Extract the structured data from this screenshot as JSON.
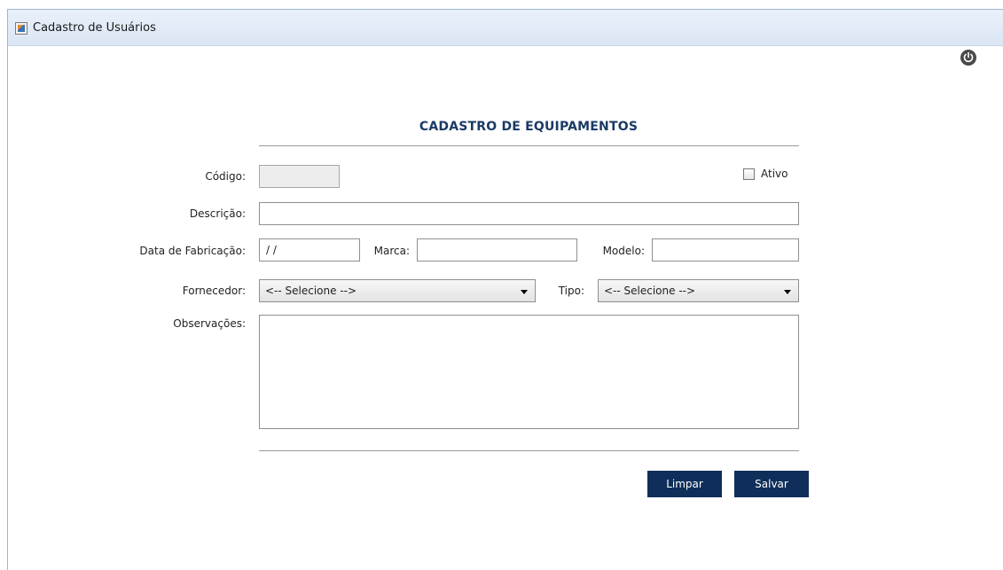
{
  "window": {
    "title": "Cadastro de Usuários"
  },
  "form": {
    "heading": "CADASTRO DE EQUIPAMENTOS",
    "codigo_label": "Código:",
    "codigo_value": "",
    "ativo_label": "Ativo",
    "ativo_checked": false,
    "descricao_label": "Descrição:",
    "descricao_value": "",
    "data_fabricacao_label": "Data de Fabricação:",
    "data_fabricacao_value": "/ /",
    "marca_label": "Marca:",
    "marca_value": "",
    "modelo_label": "Modelo:",
    "modelo_value": "",
    "fornecedor_label": "Fornecedor:",
    "fornecedor_selected": "<-- Selecione -->",
    "tipo_label": "Tipo:",
    "tipo_selected": "<-- Selecione -->",
    "observacoes_label": "Observações:",
    "observacoes_value": ""
  },
  "buttons": {
    "limpar": "Limpar",
    "salvar": "Salvar"
  },
  "icons": {
    "app": "java-app-icon",
    "power": "power-icon"
  }
}
